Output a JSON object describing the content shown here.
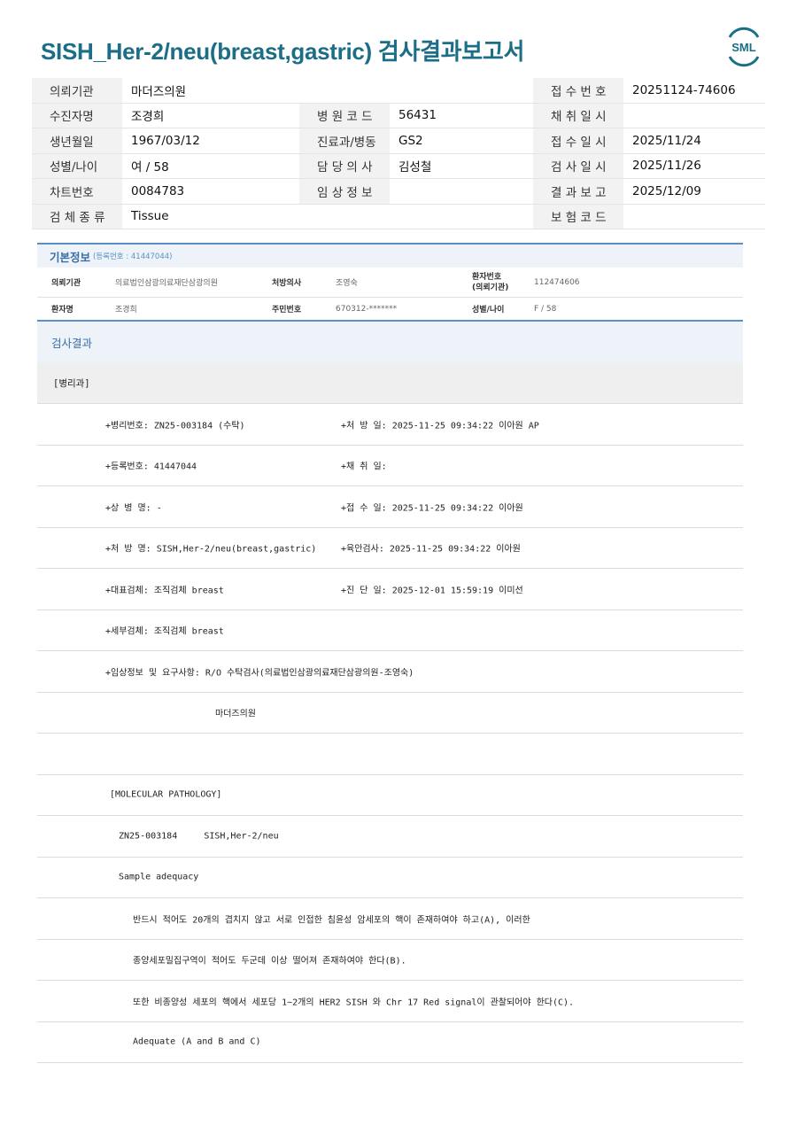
{
  "title": "SISH_Her-2/neu(breast,gastric) 검사결과보고서",
  "logo_text": "SML",
  "header": {
    "rows": [
      {
        "l1": "의뢰기관",
        "v1": "마더즈의원",
        "l2": "",
        "v2": "",
        "l3": "접 수 번 호",
        "v3": "20251124-74606"
      },
      {
        "l1": "수진자명",
        "v1": "조경희",
        "l2": "병 원 코 드",
        "v2": "56431",
        "l3": "채 취 일 시",
        "v3": ""
      },
      {
        "l1": "생년월일",
        "v1": "1967/03/12",
        "l2": "진료과/병동",
        "v2": "GS2",
        "l3": "접 수 일 시",
        "v3": "2025/11/24"
      },
      {
        "l1": "성별/나이",
        "v1": "여 / 58",
        "l2": "담 당 의 사",
        "v2": "김성철",
        "l3": "검 사 일 시",
        "v3": "2025/11/26"
      },
      {
        "l1": "차트번호",
        "v1": "0084783",
        "l2": "임 상 정 보",
        "v2": "",
        "l3": "결 과 보 고",
        "v3": "2025/12/09"
      },
      {
        "l1": "검 체 종 류",
        "v1": "Tissue",
        "l2": "",
        "v2": "",
        "l3": "보 험 코 드",
        "v3": ""
      }
    ]
  },
  "basic_info": {
    "title": "기본정보",
    "sub": "(등록번호 : 41447044)",
    "row1": {
      "l1": "의뢰기관",
      "v1": "의료법인삼광의료재단삼광의원",
      "l2": "처방의사",
      "v2": "조영숙",
      "l3a": "환자번호",
      "l3b": "(의뢰기관)",
      "v3": "112474606"
    },
    "row2": {
      "l1": "환자명",
      "v1": "조경희",
      "l2": "주민번호",
      "v2": "670312-*******",
      "l3": "성별/나이",
      "v3": "F / 58"
    }
  },
  "results": {
    "title": "검사결과",
    "dept": "[병리과]",
    "lines": [
      {
        "a": "+병리번호: ZN25-003184 (수탁)",
        "b": "+처 방 일: 2025-11-25 09:34:22  이아원 AP"
      },
      {
        "a": "+등록번호: 41447044",
        "b": "+채 취 일:"
      },
      {
        "a": "+상 병 명: -",
        "b": "+접 수 일: 2025-11-25 09:34:22  이아원"
      },
      {
        "a": "+처 방 명: SISH,Her-2/neu(breast,gastric)",
        "b": "+육안검사: 2025-11-25 09:34:22  이아원"
      },
      {
        "a": "+대표검체: 조직검체 breast",
        "b": "+진 단 일: 2025-12-01 15:59:19  이미선"
      },
      {
        "a": "+세부검체: 조직검체 breast",
        "b": ""
      },
      {
        "a": "+임상정보 및 요구사항: R/O 수탁검사(의료법인삼광의료재단삼광의원-조영숙)",
        "b": ""
      },
      {
        "a": "마더즈의원",
        "b": ""
      },
      {
        "a": "",
        "b": ""
      },
      {
        "a": "[MOLECULAR PATHOLOGY]",
        "b": ""
      },
      {
        "a": "ZN25-003184     SISH,Her-2/neu",
        "b": ""
      },
      {
        "a": "Sample adequacy",
        "b": ""
      },
      {
        "a": "반드시 적어도 20개의 겹치지 않고 서로 인접한 침윤성 암세포의 핵이 존재하여야 하고(A), 이러한",
        "b": ""
      },
      {
        "a": "종양세포밀집구역이 적어도 두군데 이상 떨어져 존재하여야 한다(B).",
        "b": ""
      },
      {
        "a": "또한 비종양성 세포의 핵에서 세포당 1~2개의 HER2 SISH 와 Chr 17 Red signal이 관찰되어야 한다(C).",
        "b": ""
      },
      {
        "a": "Adequate (A and B and C)",
        "b": ""
      }
    ]
  }
}
